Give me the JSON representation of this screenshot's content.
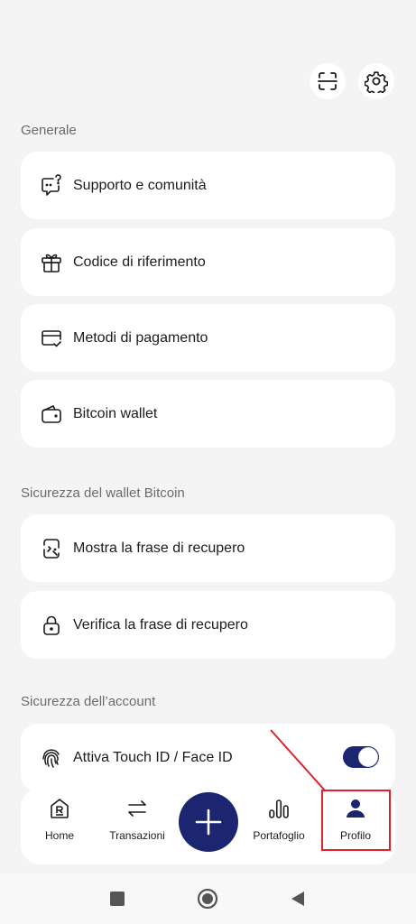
{
  "header": {
    "scan_icon": "scan-icon",
    "settings_icon": "gear-icon"
  },
  "sections": {
    "general": "Generale",
    "wallet_security": "Sicurezza del wallet Bitcoin",
    "account_security": "Sicurezza dell’account"
  },
  "items": {
    "support": "Supporto e comunità",
    "referral": "Codice di riferimento",
    "payment": "Metodi di pagamento",
    "wallet": "Bitcoin wallet",
    "show_phrase": "Mostra la frase di recupero",
    "verify_phrase": "Verifica la frase di recupero",
    "touch_id": "Attiva Touch ID / Face ID"
  },
  "touch_id_enabled": true,
  "tabs": {
    "home": "Home",
    "transactions": "Transazioni",
    "portfolio": "Portafoglio",
    "profile": "Profilo"
  },
  "colors": {
    "accent": "#1b2570",
    "annotation": "#e0202a",
    "background": "#f4f4f4"
  }
}
